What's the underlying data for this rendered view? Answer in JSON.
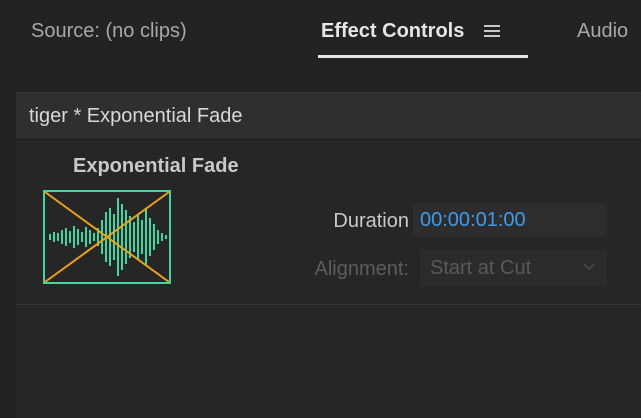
{
  "tabs": {
    "source": "Source: (no clips)",
    "effect_controls": "Effect Controls",
    "audio": "Audio"
  },
  "panel": {
    "header_title": "tiger * Exponential Fade",
    "effect_name": "Exponential Fade",
    "duration_label": "Duration",
    "duration_value": "00:00:01:00",
    "alignment_label": "Alignment:",
    "alignment_value": "Start at Cut"
  },
  "icons": {
    "panel_menu": "hamburger-menu-icon",
    "alignment_dropdown": "chevron-down-icon",
    "effect_thumbnail": "exponential-fade-waveform-icon"
  },
  "colors": {
    "background": "#232323",
    "panel_header": "#2f2f2f",
    "timecode": "#3b9ced",
    "waveform": "#3fd6a2",
    "fade_cross": "#e8a317"
  }
}
